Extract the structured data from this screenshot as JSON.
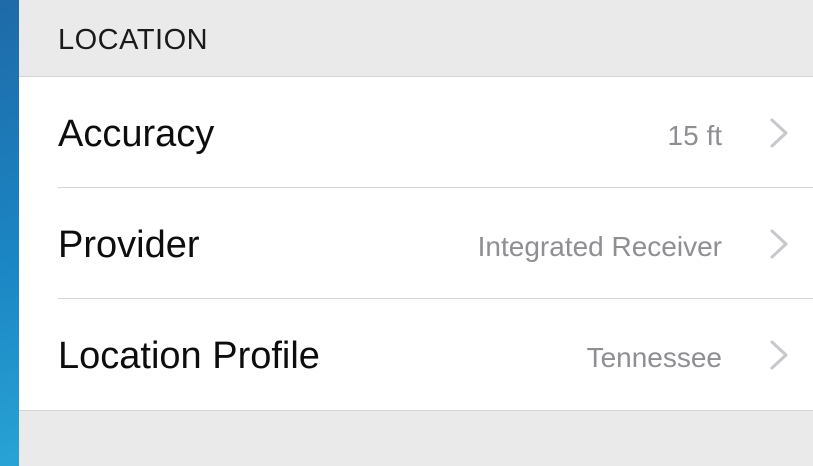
{
  "section": {
    "title": "LOCATION"
  },
  "rows": [
    {
      "label": "Accuracy",
      "value": "15 ft"
    },
    {
      "label": "Provider",
      "value": "Integrated Receiver"
    },
    {
      "label": "Location Profile",
      "value": "Tennessee"
    }
  ],
  "icons": {
    "disclosure": "chevron-right-icon"
  },
  "colors": {
    "background_gradient_start": "#1f6aa8",
    "background_gradient_end": "#2aa6d6",
    "panel_background": "#eaeaea",
    "cell_background": "#ffffff",
    "value_text": "#8e8e93",
    "chevron": "#c7c7cc"
  }
}
